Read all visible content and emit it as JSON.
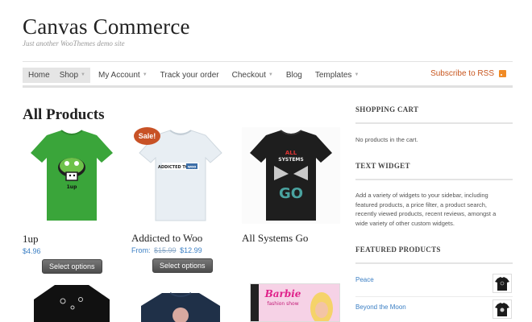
{
  "site": {
    "title": "Canvas Commerce",
    "description": "Just another WooThemes demo site"
  },
  "nav": {
    "items": [
      {
        "label": "Home",
        "has_caret": false
      },
      {
        "label": "Shop",
        "has_caret": true
      },
      {
        "label": "My Account",
        "has_caret": true
      },
      {
        "label": "Track your order",
        "has_caret": false
      },
      {
        "label": "Checkout",
        "has_caret": true
      },
      {
        "label": "Blog",
        "has_caret": false
      },
      {
        "label": "Templates",
        "has_caret": true
      }
    ],
    "rss_label": "Subscribe to RSS",
    "caret": "▼"
  },
  "main": {
    "title": "All Products",
    "products": [
      {
        "name": "1up",
        "price": "$4.96",
        "button": "Select options"
      },
      {
        "name": "Addicted to Woo",
        "price_prefix": "From:",
        "price_old": "$15.99",
        "price": "$12.99",
        "button": "Select options",
        "badge": "Sale!"
      },
      {
        "name": "All Systems Go"
      }
    ]
  },
  "sidebar": {
    "cart": {
      "title": "SHOPPING CART",
      "text": "No products in the cart."
    },
    "text_widget": {
      "title": "TEXT WIDGET",
      "text": "Add a variety of widgets to your sidebar, including featured products, a price filter, a product search, recently viewed products, recent reviews, amongst a wide variety of other custom widgets."
    },
    "featured": {
      "title": "FEATURED PRODUCTS",
      "items": [
        {
          "label": "Peace"
        },
        {
          "label": "Beyond the Moon"
        }
      ]
    }
  },
  "colors": {
    "link": "#3b7fc4",
    "rss": "#c8561e",
    "sale_badge": "#c85226"
  },
  "icons": [
    "rss-icon",
    "caret-down-icon"
  ]
}
